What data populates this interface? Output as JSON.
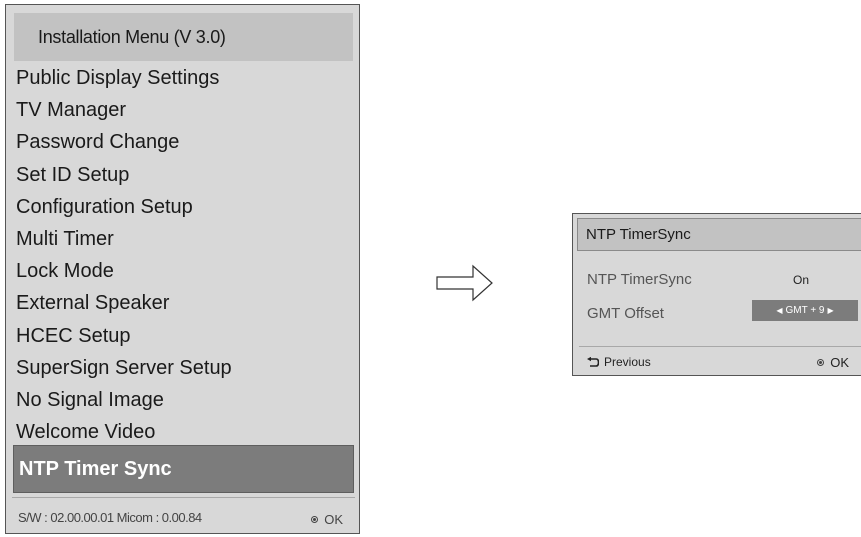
{
  "installation_menu": {
    "title": "Installation Menu (V 3.0)",
    "items": [
      "Public Display Settings",
      "TV Manager",
      "Password Change",
      "Set ID Setup",
      "Configuration Setup",
      "Multi Timer",
      "Lock Mode",
      "External Speaker",
      "HCEC Setup",
      "SuperSign Server Setup",
      "No Signal Image",
      "Welcome Video"
    ],
    "selected_item": "NTP Timer Sync",
    "footer_info": "S/W : 02.00.00.01 Micom : 0.00.84",
    "ok_label": "OK"
  },
  "ntp_dialog": {
    "title": "NTP TimerSync",
    "rows": [
      {
        "label": "NTP TimerSync",
        "value": "On"
      },
      {
        "label": "GMT Offset",
        "value": "GMT + 9"
      }
    ],
    "previous_label": "Previous",
    "ok_label": "OK"
  }
}
